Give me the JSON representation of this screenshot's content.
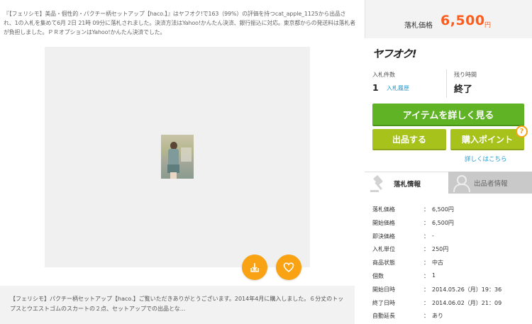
{
  "description": "『【フェリシモ】美品・個性的・パクチー柄セットアップ【haco.】』はヤフオク!で163（99%）の評価を持つcat_apple_1125から出品され、1の入札を集めて6月 2日 21時 09分に落札されました。決済方法はYahoo!かんたん決済、銀行振込に対応。東京都からの発送料は落札者が負担しました。ＰＲオプションはYahoo!かんたん決済でした。",
  "summary": "【フェリシモ】パクチー柄セットアップ【haco.】ご覧いただきありがとうございます。2014年4月に購入しました。６分丈のトップスとウエストゴムのスカートの２点、セットアップでの出品とな...",
  "price": {
    "label": "落札価格",
    "value": "6,500",
    "unit": "円"
  },
  "logo": "ヤフオク!",
  "stats": {
    "bids_label": "入札件数",
    "bids_count": "1",
    "history_link": "入札履歴",
    "remaining_label": "残り時間",
    "remaining_value": "終了"
  },
  "buttons": {
    "detail": "アイテムを詳しく見る",
    "sell": "出品する",
    "point": "購入ポイント",
    "help_badge": "?",
    "more_link": "詳しくはこちら"
  },
  "tabs": {
    "auction_info": "落札情報",
    "seller_info": "出品者情報"
  },
  "info_sep": "：",
  "info_rows": [
    {
      "label": "落札価格",
      "value": "6,500円"
    },
    {
      "label": "開始価格",
      "value": "6,500円"
    },
    {
      "label": "即決価格",
      "value": "-"
    },
    {
      "label": "入札単位",
      "value": "250円"
    },
    {
      "label": "商品状態",
      "value": "中古"
    },
    {
      "label": "個数",
      "value": "1"
    },
    {
      "label": "開始日時",
      "value": "2014.05.26（月）19：36"
    },
    {
      "label": "終了日時",
      "value": "2014.06.02（月）21：09"
    },
    {
      "label": "自動延長",
      "value": "あり"
    }
  ],
  "colors": {
    "accent_orange": "#f8a214",
    "price_red": "#ff5b1a",
    "green": "#5fb325",
    "olive": "#a6c21b",
    "link": "#2196c9"
  },
  "icons": [
    "share-icon",
    "heart-icon",
    "gavel-icon",
    "person-icon",
    "question-icon"
  ]
}
